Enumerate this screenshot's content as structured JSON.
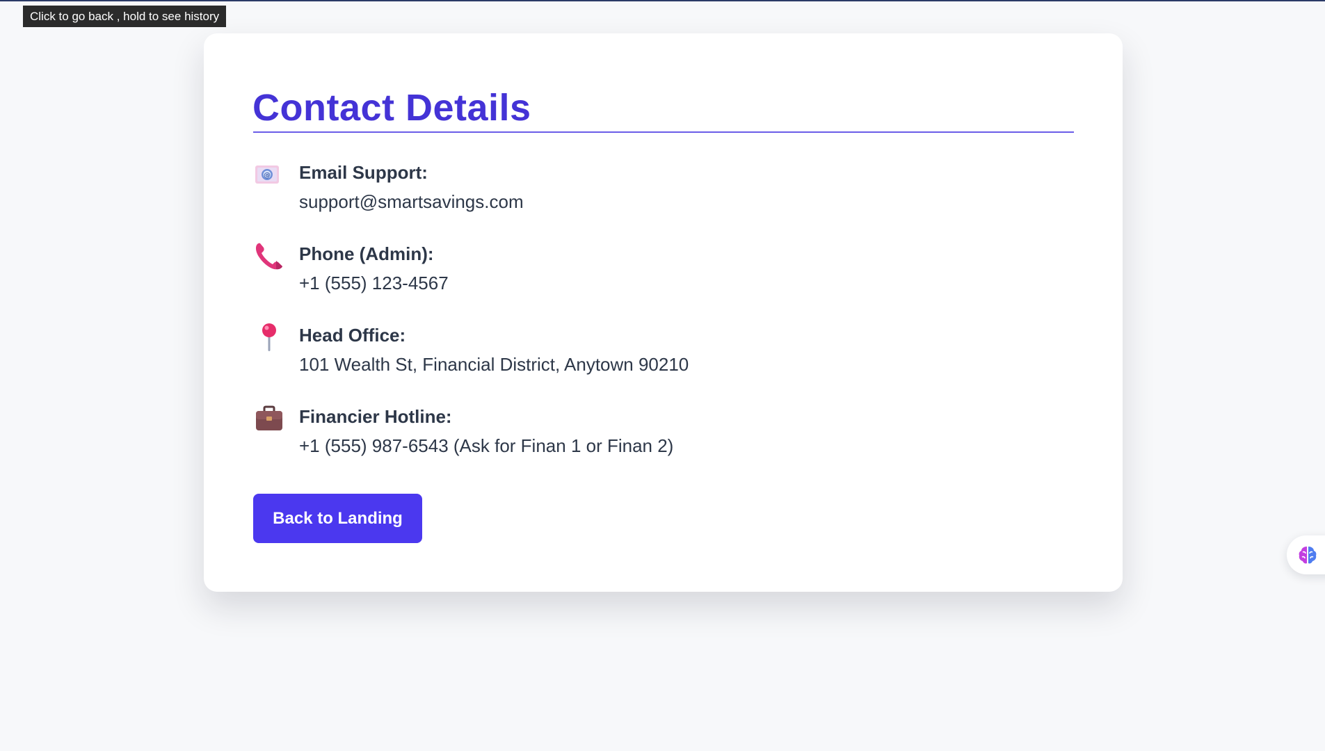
{
  "browser": {
    "tooltip": "Click to go back , hold to see history"
  },
  "page": {
    "title": "Contact Details"
  },
  "contacts": [
    {
      "icon": "email-icon",
      "label": "Email Support:",
      "value": "support@smartsavings.com"
    },
    {
      "icon": "phone-icon",
      "label": "Phone (Admin):",
      "value": "+1 (555) 123-4567"
    },
    {
      "icon": "location-pin-icon",
      "label": "Head Office:",
      "value": "101 Wealth St, Financial District, Anytown 90210"
    },
    {
      "icon": "briefcase-icon",
      "label": "Financier Hotline:",
      "value": "+1 (555) 987-6543 (Ask for Finan 1 or Finan 2)"
    }
  ],
  "actions": {
    "back_label": "Back to Landing"
  },
  "widget": {
    "icon": "brain-icon"
  },
  "colors": {
    "accent": "#4433d6",
    "button": "#4b38ef",
    "background": "#f7f8fa",
    "card": "#ffffff",
    "text": "#2d3748"
  }
}
